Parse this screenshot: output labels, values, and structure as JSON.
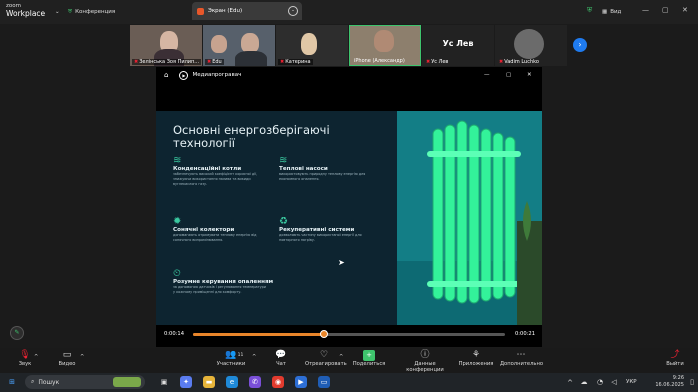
{
  "app": {
    "logo_top": "zoom",
    "logo_bottom": "Workplace"
  },
  "topbar": {
    "conference_label": "Конференция",
    "tab_label": "Экран (Edu)",
    "view_label": "Вид"
  },
  "participants": [
    {
      "name": "Зелінська Зоя Пилип..."
    },
    {
      "name": "Edu"
    },
    {
      "name": "Катерина"
    },
    {
      "name": "iPhone (Александр)"
    },
    {
      "name": "Ус Лев",
      "display_name": "Ус Лев"
    },
    {
      "name": "Vadim Luchko"
    }
  ],
  "media": {
    "title": "Медиапрогравач",
    "slide_title": "Основні енергозберігаючі технології",
    "features": [
      {
        "title": "Конденсаційні котли",
        "desc": "забезпечують високий коефіцієнт корисної дії, знижуючи використання палива та викиди вуглекислого газу."
      },
      {
        "title": "Теплові насоси",
        "desc": "використовують природну теплову енергію для економного опалення."
      },
      {
        "title": "Сонячні колектори",
        "desc": "допомагають отримувати теплову енергію від сонячного випромінювання."
      },
      {
        "title": "Рекуперативні системи",
        "desc": "дозволяють частину використаної енергії для повторного нагріву."
      },
      {
        "title": "Розумне керування опаленням",
        "desc": "за допомогою датчиків і регулювання температури у кожному приміщенні для комфорту."
      }
    ],
    "time_current": "0:00:14",
    "time_total": "0:00:21",
    "progress": 0.42
  },
  "toolbar": {
    "audio": "Звук",
    "video": "Видео",
    "participants": "Участники",
    "participants_count": "11",
    "chat": "Чат",
    "react": "Отреагировать",
    "share": "Поделиться",
    "conf_data": "Данные конференции",
    "apps": "Приложения",
    "more": "Дополнительно",
    "leave": "Выйти"
  },
  "taskbar": {
    "search_placeholder": "Пошук",
    "lang": "УКР",
    "time": "9:26",
    "date": "16.06.2025"
  }
}
